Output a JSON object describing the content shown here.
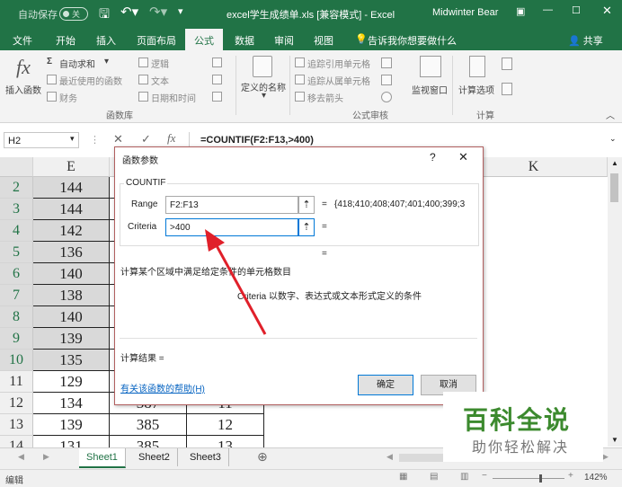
{
  "titlebar": {
    "autosave": "自动保存",
    "autosave_state": "关",
    "filename": "excel学生成绩单.xls  [兼容模式]  -  Excel",
    "user": "Midwinter Bear",
    "accent": "#217346"
  },
  "tabs": [
    {
      "label": "文件"
    },
    {
      "label": "开始"
    },
    {
      "label": "插入"
    },
    {
      "label": "页面布局"
    },
    {
      "label": "公式",
      "active": true
    },
    {
      "label": "数据"
    },
    {
      "label": "审阅"
    },
    {
      "label": "视图"
    }
  ],
  "tellme": "告诉我你想要做什么",
  "share": "共享",
  "ribbon": {
    "insert_function": "插入函数",
    "autosum": "自动求和",
    "recent": "最近使用的函数",
    "financial": "财务",
    "logical": "逻辑",
    "text": "文本",
    "datetime": "日期和时间",
    "defined_names": "定义的名称",
    "trace_precedents": "追踪引用单元格",
    "trace_dependents": "追踪从属单元格",
    "remove_arrows": "移去箭头",
    "watch_window": "监视窗口",
    "calc_options": "计算选项",
    "group_library": "函数库",
    "group_audit": "公式审核",
    "group_calc": "计算"
  },
  "formula_bar": {
    "name_box": "H2",
    "formula": "=COUNTIF(F2:F13,>400)"
  },
  "grid": {
    "col_e": "E",
    "col_k": "K",
    "rows": [
      {
        "num": "2",
        "e": "144",
        "f": "",
        "g": ""
      },
      {
        "num": "3",
        "e": "144",
        "f": "",
        "g": ""
      },
      {
        "num": "4",
        "e": "142",
        "f": "",
        "g": ""
      },
      {
        "num": "5",
        "e": "136",
        "f": "",
        "g": ""
      },
      {
        "num": "6",
        "e": "140",
        "f": "",
        "g": ""
      },
      {
        "num": "7",
        "e": "138",
        "f": "",
        "g": ""
      },
      {
        "num": "8",
        "e": "140",
        "f": "",
        "g": ""
      },
      {
        "num": "9",
        "e": "139",
        "f": "",
        "g": ""
      },
      {
        "num": "10",
        "e": "135",
        "f": "",
        "g": ""
      },
      {
        "num": "11",
        "e": "129",
        "f": "",
        "g": ""
      },
      {
        "num": "12",
        "e": "134",
        "f": "387",
        "g": "11"
      },
      {
        "num": "13",
        "e": "139",
        "f": "385",
        "g": "12"
      },
      {
        "num": "14",
        "e": "131",
        "f": "385",
        "g": "13"
      }
    ]
  },
  "sheets": [
    {
      "label": "Sheet1",
      "active": true
    },
    {
      "label": "Sheet2"
    },
    {
      "label": "Sheet3"
    }
  ],
  "status": {
    "mode": "编辑",
    "zoom": "142%"
  },
  "dialog": {
    "title": "函数参数",
    "help": "?",
    "function_name": "COUNTIF",
    "range_label": "Range",
    "range_value": "F2:F13",
    "range_result": "{418;410;408;407;401;400;399;3",
    "criteria_label": "Criteria",
    "criteria_value": ">400",
    "eq": "=",
    "description": "计算某个区域中满足给定条件的单元格数目",
    "param_desc": "Criteria  以数字、表达式或文本形式定义的条件",
    "result_label": "计算结果 =",
    "help_link": "有关该函数的帮助(H)",
    "ok": "确定",
    "cancel": "取消"
  },
  "watermark": {
    "title": "百科全说",
    "subtitle": "助你轻松解决"
  }
}
